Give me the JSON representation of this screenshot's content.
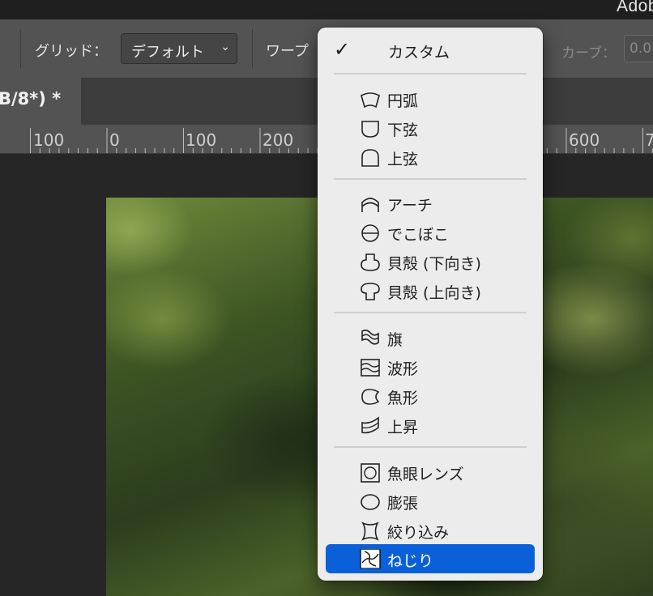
{
  "app": {
    "title": "Adob"
  },
  "options_bar": {
    "grid_label": "グリッド：",
    "grid_value": "デフォルト",
    "warp_label": "ワープ",
    "curve_label": "カーブ：",
    "curve_value": "0.0"
  },
  "document_tab": {
    "title": "B/8*) *"
  },
  "ruler": {
    "labels": [
      "100",
      "0",
      "100",
      "200",
      "600",
      "7"
    ]
  },
  "warp_menu": {
    "custom_label": "カスタム",
    "groups": [
      [
        {
          "label": "円弧",
          "icon": "arc-icon"
        },
        {
          "label": "下弦",
          "icon": "arc-lower-icon"
        },
        {
          "label": "上弦",
          "icon": "arc-upper-icon"
        }
      ],
      [
        {
          "label": "アーチ",
          "icon": "arch-icon"
        },
        {
          "label": "でこぼこ",
          "icon": "bulge-icon"
        },
        {
          "label": "貝殻 (下向き)",
          "icon": "shell-lower-icon"
        },
        {
          "label": "貝殻 (上向き)",
          "icon": "shell-upper-icon"
        }
      ],
      [
        {
          "label": "旗",
          "icon": "flag-icon"
        },
        {
          "label": "波形",
          "icon": "wave-icon"
        },
        {
          "label": "魚形",
          "icon": "fish-icon"
        },
        {
          "label": "上昇",
          "icon": "rise-icon"
        }
      ],
      [
        {
          "label": "魚眼レンズ",
          "icon": "fisheye-icon"
        },
        {
          "label": "膨張",
          "icon": "inflate-icon"
        },
        {
          "label": "絞り込み",
          "icon": "squeeze-icon"
        },
        {
          "label": "ねじり",
          "icon": "twist-icon"
        }
      ]
    ],
    "selected_label": "ねじり",
    "selected_color": "#0a60d8"
  }
}
